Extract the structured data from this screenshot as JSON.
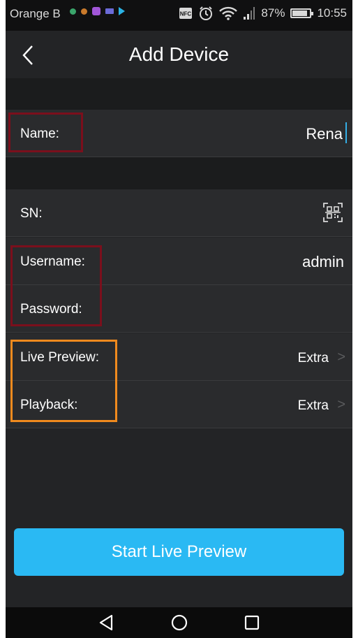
{
  "status_bar": {
    "carrier": "Orange B",
    "battery": "87%",
    "battery_level": 0.87,
    "time": "10:55",
    "icons": [
      "notification-icon",
      "notification-icon",
      "gallery-icon",
      "email-icon",
      "play-store-icon",
      "nfc-icon",
      "alarm-icon",
      "wifi-icon",
      "signal-icon",
      "battery-icon"
    ]
  },
  "header": {
    "title": "Add Device",
    "back_icon": "chevron-left-icon"
  },
  "form": {
    "name": {
      "label": "Name:",
      "value": "Rena"
    },
    "sn": {
      "label": "SN:",
      "icon": "qr-scan-icon"
    },
    "username": {
      "label": "Username:",
      "value": "admin"
    },
    "password": {
      "label": "Password:",
      "value": ""
    },
    "live_preview": {
      "label": "Live Preview:",
      "value": "Extra"
    },
    "playback": {
      "label": "Playback:",
      "value": "Extra"
    }
  },
  "chevron": ">",
  "start_button": {
    "label": "Start Live Preview"
  },
  "nav_bar": {
    "icons": [
      "back-triangle-icon",
      "home-circle-icon",
      "recents-square-icon"
    ]
  },
  "colors": {
    "background": "#232426",
    "row": "#2a2b2d",
    "accent": "#2ab9f3",
    "highlight_red": "#7b0f1c",
    "highlight_orange": "#f08a1e"
  }
}
